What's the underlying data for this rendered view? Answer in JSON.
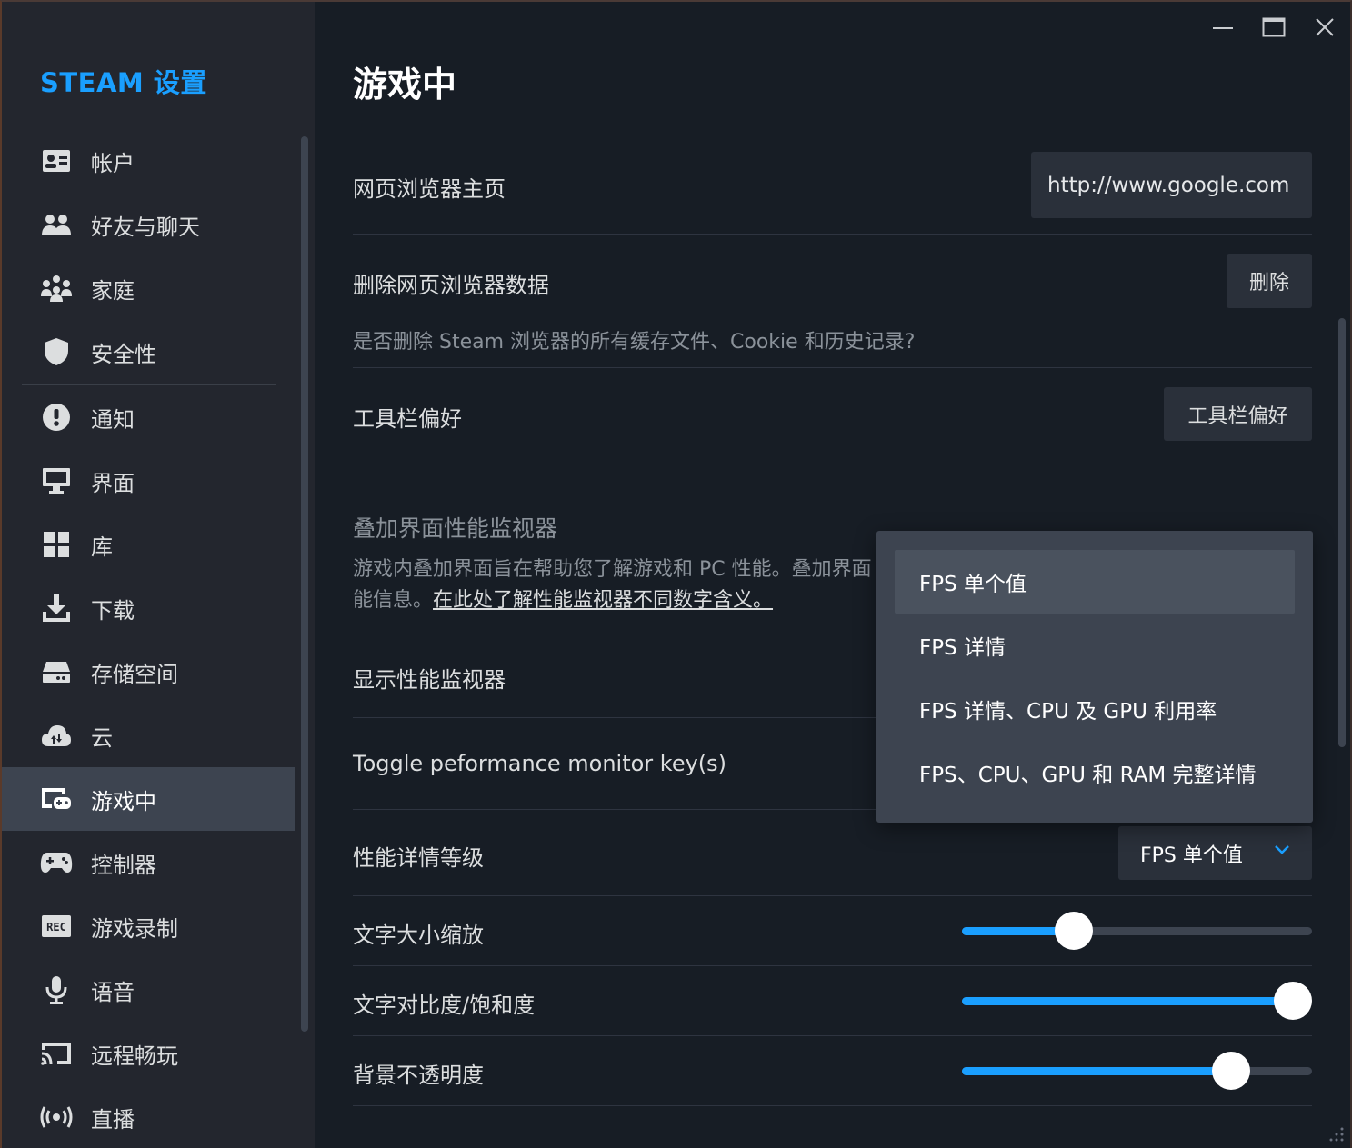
{
  "sidebar": {
    "title": "STEAM 设置",
    "items": [
      {
        "label": "帐户",
        "icon": "account-card-icon"
      },
      {
        "label": "好友与聊天",
        "icon": "friends-icon"
      },
      {
        "label": "家庭",
        "icon": "family-icon"
      },
      {
        "label": "安全性",
        "icon": "shield-icon"
      },
      {
        "label": "通知",
        "icon": "alert-icon"
      },
      {
        "label": "界面",
        "icon": "monitor-icon"
      },
      {
        "label": "库",
        "icon": "grid-icon"
      },
      {
        "label": "下载",
        "icon": "download-icon"
      },
      {
        "label": "存储空间",
        "icon": "storage-icon"
      },
      {
        "label": "云",
        "icon": "cloud-icon"
      },
      {
        "label": "游戏中",
        "icon": "in-game-icon",
        "active": true
      },
      {
        "label": "控制器",
        "icon": "controller-icon"
      },
      {
        "label": "游戏录制",
        "icon": "rec-icon"
      },
      {
        "label": "语音",
        "icon": "microphone-icon"
      },
      {
        "label": "远程畅玩",
        "icon": "cast-icon"
      },
      {
        "label": "直播",
        "icon": "broadcast-icon"
      }
    ]
  },
  "main": {
    "title": "游戏中",
    "homepage": {
      "label": "网页浏览器主页",
      "value": "http://www.google.com"
    },
    "delete_data": {
      "label": "删除网页浏览器数据",
      "button": "删除",
      "description": "是否删除 Steam 浏览器的所有缓存文件、Cookie 和历史记录?"
    },
    "toolbar": {
      "label": "工具栏偏好",
      "button": "工具栏偏好"
    },
    "overlay": {
      "heading": "叠加界面性能监视器",
      "description_line1": "游戏内叠加界面旨在帮助您了解游戏和 PC 性能。叠加界面",
      "description_line2_prefix": "能信息。",
      "description_link": "在此处了解性能监视器不同数字含义。"
    },
    "show_monitor": {
      "label": "显示性能监视器"
    },
    "toggle_key": {
      "label": "Toggle peformance monitor key(s)"
    },
    "detail_level": {
      "label": "性能详情等级",
      "selected": "FPS 单个值",
      "options": [
        "FPS 单个值",
        "FPS 详情",
        "FPS 详情、CPU 及 GPU 利用率",
        "FPS、CPU、GPU 和 RAM 完整详情"
      ]
    },
    "sliders": [
      {
        "label": "文字大小缩放",
        "value_fraction": 0.32
      },
      {
        "label": "文字对比度/饱和度",
        "value_fraction": 0.945
      },
      {
        "label": "背景不透明度",
        "value_fraction": 0.77
      }
    ]
  },
  "colors": {
    "accent": "#1a9fff",
    "sidebar_bg": "#23262e",
    "main_bg": "#171d25",
    "active_item_bg": "#3d4450"
  }
}
